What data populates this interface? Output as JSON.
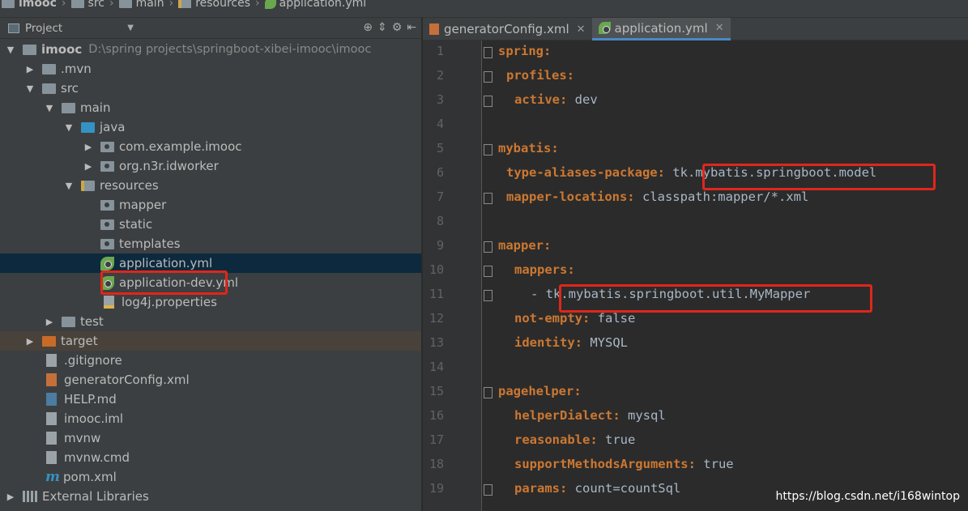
{
  "breadcrumb": {
    "items": [
      "imooc",
      "src",
      "main",
      "resources",
      "application.yml"
    ]
  },
  "project_panel": {
    "title": "Project",
    "tree": [
      {
        "label": "imooc",
        "path": "D:\\spring projects\\springboot-xibei-imooc\\imooc"
      },
      {
        "label": ".mvn"
      },
      {
        "label": "src"
      },
      {
        "label": "main"
      },
      {
        "label": "java"
      },
      {
        "label": "com.example.imooc"
      },
      {
        "label": "org.n3r.idworker"
      },
      {
        "label": "resources"
      },
      {
        "label": "mapper"
      },
      {
        "label": "static"
      },
      {
        "label": "templates"
      },
      {
        "label": "application.yml"
      },
      {
        "label": "application-dev.yml"
      },
      {
        "label": "log4j.properties"
      },
      {
        "label": "test"
      },
      {
        "label": "target"
      },
      {
        "label": ".gitignore"
      },
      {
        "label": "generatorConfig.xml"
      },
      {
        "label": "HELP.md"
      },
      {
        "label": "imooc.iml"
      },
      {
        "label": "mvnw"
      },
      {
        "label": "mvnw.cmd"
      },
      {
        "label": "pom.xml"
      },
      {
        "label": "External Libraries"
      }
    ]
  },
  "tabs": [
    {
      "label": "generatorConfig.xml"
    },
    {
      "label": "application.yml"
    }
  ],
  "editor": {
    "line_numbers": [
      "1",
      "2",
      "3",
      "4",
      "5",
      "6",
      "7",
      "8",
      "9",
      "10",
      "11",
      "12",
      "13",
      "14",
      "15",
      "16",
      "17",
      "18",
      "19"
    ],
    "lines": [
      {
        "key": "spring:",
        "value": ""
      },
      {
        "key": "profiles:",
        "value": ""
      },
      {
        "key": "active:",
        "value": " dev"
      },
      {
        "key": "",
        "value": ""
      },
      {
        "key": "mybatis:",
        "value": ""
      },
      {
        "key": "type-aliases-package:",
        "value": " tk.mybatis.springboot.model"
      },
      {
        "key": "mapper-locations:",
        "value": " classpath:mapper/*.xml"
      },
      {
        "key": "",
        "value": ""
      },
      {
        "key": "mapper:",
        "value": ""
      },
      {
        "key": "mappers:",
        "value": ""
      },
      {
        "key": "",
        "value": "- tk.mybatis.springboot.util.MyMapper"
      },
      {
        "key": "not-empty:",
        "value": " false"
      },
      {
        "key": "identity:",
        "value": " MYSQL"
      },
      {
        "key": "",
        "value": ""
      },
      {
        "key": "pagehelper:",
        "value": ""
      },
      {
        "key": "helperDialect:",
        "value": " mysql"
      },
      {
        "key": "reasonable:",
        "value": " true"
      },
      {
        "key": "supportMethodsArguments:",
        "value": " true"
      },
      {
        "key": "params:",
        "value": " count=countSql"
      }
    ]
  },
  "watermark": "https://blog.csdn.net/i168wintop",
  "colors": {
    "highlight_box": "#e0261b",
    "key": "#cc7832",
    "selection": "#0d293e"
  }
}
